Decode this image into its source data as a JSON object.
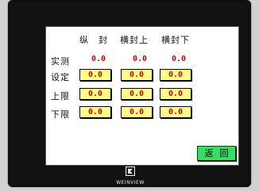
{
  "columns": [
    "纵　封",
    "横封上",
    "横封下"
  ],
  "rows": [
    {
      "label": "实测",
      "values": [
        "0.0",
        "0.0",
        "0.0"
      ]
    },
    {
      "label": "设定",
      "values": [
        "0.0",
        "0.0",
        "0.0"
      ]
    },
    {
      "label": "上限",
      "values": [
        "0.0",
        "0.0",
        "0.0"
      ]
    },
    {
      "label": "下限",
      "values": [
        "0.0",
        "0.0",
        "0.0"
      ]
    }
  ],
  "back_button_label": "返回",
  "brand": "WEINVIEW",
  "colors": {
    "screen_bg": "#ffffff",
    "input_bg": "#ffff88",
    "value_text": "#e00000",
    "back_button": "#33dd66",
    "bezel": "#121212"
  }
}
